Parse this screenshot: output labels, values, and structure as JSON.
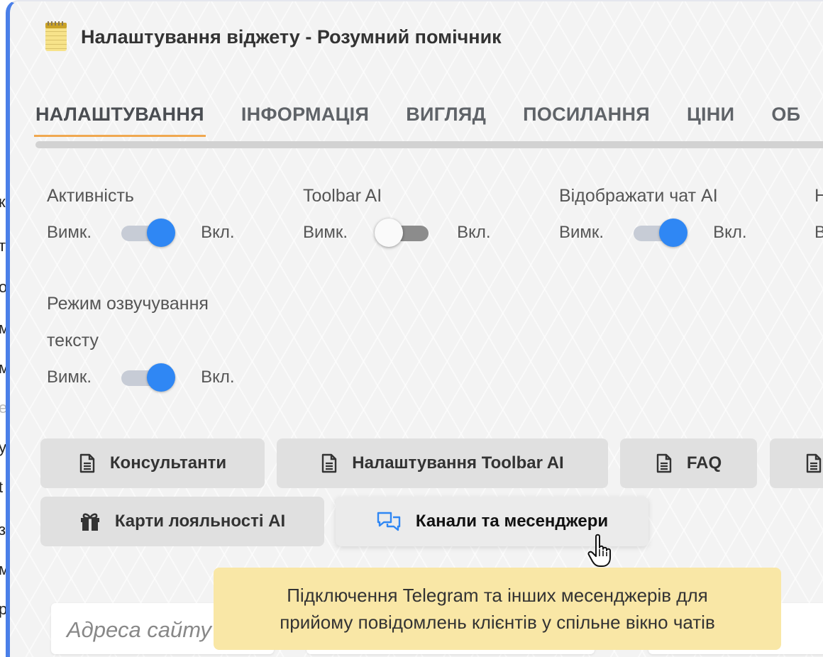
{
  "window": {
    "title": "Налаштування віджету - Розумний помічник",
    "icon": "notepad-icon"
  },
  "tabs": [
    {
      "label": "НАЛАШТУВАННЯ",
      "active": true
    },
    {
      "label": "ІНФОРМАЦІЯ"
    },
    {
      "label": "ВИГЛЯД"
    },
    {
      "label": "ПОСИЛАННЯ"
    },
    {
      "label": "ЦІНИ"
    },
    {
      "label": "ОБ"
    }
  ],
  "toggles": [
    {
      "label": "Активність",
      "off": "Вимк.",
      "on": "Вкл.",
      "state": true
    },
    {
      "label": "Toolbar AI",
      "off": "Вимк.",
      "on": "Вкл.",
      "state": false
    },
    {
      "label": "Відображати чат AI",
      "off": "Вимк.",
      "on": "Вкл.",
      "state": true
    },
    {
      "label": "Н",
      "off": "В",
      "on": "",
      "state": null
    },
    {
      "label_line1": "Режим озвучування",
      "label_line2": "тексту",
      "off": "Вимк.",
      "on": "Вкл.",
      "state": true
    }
  ],
  "buttons": [
    {
      "label": "Консультанти",
      "icon": "document-icon"
    },
    {
      "label": "Налаштування Toolbar AI",
      "icon": "document-icon"
    },
    {
      "label": "FAQ",
      "icon": "document-icon"
    },
    {
      "label": "",
      "icon": "document-icon"
    },
    {
      "label": "Карти лояльності AI",
      "icon": "gift-icon"
    },
    {
      "label": "Канали та месенджери",
      "icon": "chat-bubbles-icon",
      "hovered": true
    }
  ],
  "inputs": {
    "site_address_placeholder": "Адреса сайту"
  },
  "tooltip": {
    "line1": "Підключення Telegram та інших месенджерів для",
    "line2": "прийому повідомлень клієнтів у спільне вікно чатів"
  },
  "background_letters": [
    "к",
    "т",
    "о",
    "м",
    "м",
    "е",
    "у",
    "t",
    "з",
    "м",
    "р"
  ],
  "colors": {
    "accent_blue": "#2f87f4",
    "tab_underline": "#f0a850",
    "panel_border": "#4a7fe8",
    "tooltip_bg": "#f9e7a6"
  }
}
